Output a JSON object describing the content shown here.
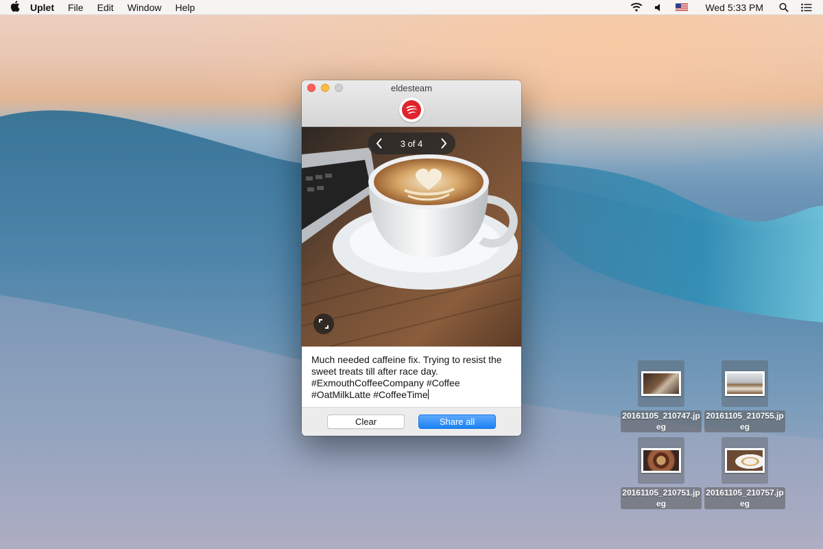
{
  "menubar": {
    "app_name": "Uplet",
    "menus": [
      "File",
      "Edit",
      "Window",
      "Help"
    ],
    "clock": "Wed 5:33 PM",
    "status_icons": [
      "wifi-icon",
      "volume-icon",
      "us-flag-icon",
      "spotlight-icon",
      "notification-center-icon"
    ]
  },
  "window": {
    "title": "eldesteam",
    "pager": {
      "label": "3 of 4"
    },
    "caption": "Much needed caffeine fix. Trying to resist the sweet treats till after race day. #ExmouthCoffeeCompany #Coffee #OatMilkLatte #CoffeeTime",
    "buttons": {
      "clear": "Clear",
      "share_all": "Share all"
    },
    "colors": {
      "share_button": "#1b82f5",
      "logo_red": "#e0242d"
    }
  },
  "desktop_files": [
    {
      "name": "20161105_210747.jpeg"
    },
    {
      "name": "20161105_210755.jpeg"
    },
    {
      "name": "20161105_210751.jpeg"
    },
    {
      "name": "20161105_210757.jpeg"
    }
  ]
}
